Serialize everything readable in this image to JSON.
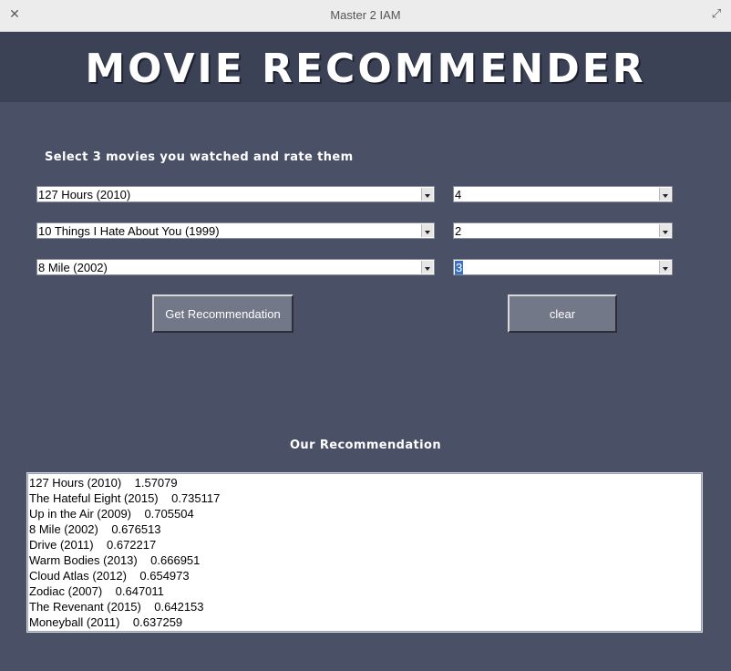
{
  "window": {
    "title": "Master 2 IAM"
  },
  "header": {
    "title": "MOVIE RECOMMENDER"
  },
  "selection": {
    "prompt": "Select 3 movies you watched and rate them",
    "movies": [
      {
        "movie": "127 Hours (2010)",
        "rating": "4"
      },
      {
        "movie": "10 Things I Hate About You (1999)",
        "rating": "2"
      },
      {
        "movie": "8 Mile (2002)",
        "rating": "3"
      }
    ]
  },
  "actions": {
    "get_label": "Get Recommendation",
    "clear_label": "clear"
  },
  "results": {
    "heading": "Our Recommendation",
    "items": [
      {
        "text": "127 Hours (2010)    1.57079"
      },
      {
        "text": "The Hateful Eight (2015)    0.735117"
      },
      {
        "text": "Up in the Air (2009)    0.705504"
      },
      {
        "text": "8 Mile (2002)    0.676513"
      },
      {
        "text": "Drive (2011)    0.672217"
      },
      {
        "text": "Warm Bodies (2013)    0.666951"
      },
      {
        "text": "Cloud Atlas (2012)    0.654973"
      },
      {
        "text": "Zodiac (2007)    0.647011"
      },
      {
        "text": "The Revenant (2015)    0.642153"
      },
      {
        "text": "Moneyball (2011)    0.637259"
      }
    ]
  },
  "icons": {
    "close": "close-icon",
    "maximize": "maximize-icon"
  }
}
